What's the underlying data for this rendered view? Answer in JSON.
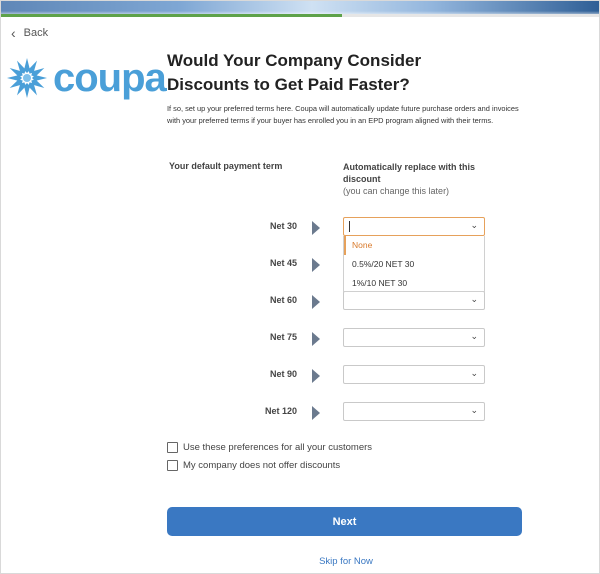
{
  "header": {
    "back_label": "Back",
    "progress_fraction": 0.57
  },
  "logo": {
    "text": "coupa"
  },
  "page": {
    "title": "Would Your Company Consider Discounts to Get Paid Faster?",
    "description": "If so, set up your preferred terms here. Coupa will automatically update future purchase orders and invoices with your preferred terms if your buyer has enrolled you in an EPD program aligned with their terms."
  },
  "columns": {
    "left_header": "Your default payment term",
    "right_header": "Automatically replace with this discount",
    "right_subheader": "(you can change this later)"
  },
  "terms": [
    {
      "label": "Net 30"
    },
    {
      "label": "Net 45"
    },
    {
      "label": "Net 60"
    },
    {
      "label": "Net 75"
    },
    {
      "label": "Net 90"
    },
    {
      "label": "Net 120"
    }
  ],
  "dropdown": {
    "open_for": "Net 30",
    "options": [
      "None",
      "0.5%/20 NET 30",
      "1%/10 NET 30"
    ],
    "highlighted": "None"
  },
  "checkboxes": [
    {
      "label": "Use these preferences for all your customers",
      "checked": false
    },
    {
      "label": "My company does not offer discounts",
      "checked": false
    }
  ],
  "actions": {
    "next_label": "Next",
    "skip_label": "Skip for Now"
  },
  "colors": {
    "brand_blue": "#4a9fd8",
    "button_blue": "#3a78c2",
    "progress_green": "#5ea24a",
    "focus_orange": "#e6a15b"
  }
}
